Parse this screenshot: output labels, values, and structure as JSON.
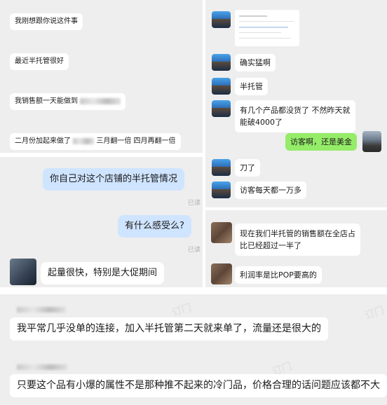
{
  "panel1": {
    "messages": [
      "我刚想跟你说这件事",
      "最近半托管很好",
      "我销售额一天能做到",
      "二月份加起来做了",
      "三月翻一倍 四月再翻一倍"
    ]
  },
  "panel2": {
    "messages": [
      "确实猛啊",
      "半托管",
      "有几个产品都没货了 不然昨天就",
      "能破4000了",
      "访客啊，还是美金",
      "刀了",
      "访客每天都一万多"
    ]
  },
  "panel3": {
    "messages": [
      "你自己对这个店铺的半托管情况",
      "有什么感受么?",
      "起量很快，特别是大促期间"
    ],
    "read_label": "已读"
  },
  "panel4": {
    "messages": [
      "现在我们半托管的销售额在全店占",
      "比已经超过一半了",
      "利润率是比POP要高的"
    ]
  },
  "panel5": {
    "messages": [
      "我平常几乎没单的连接，加入半托管第二天就来单了，流量还是很大的",
      "只要这个品有小爆的属性不是那种推不起来的冷门品，价格合理的话问题应该都不大"
    ],
    "watermark": "订门"
  },
  "colors": {
    "panel_bg": "#eeeeee",
    "blue_bubble": "#cfe4ff",
    "green_bubble": "#95ec69"
  }
}
